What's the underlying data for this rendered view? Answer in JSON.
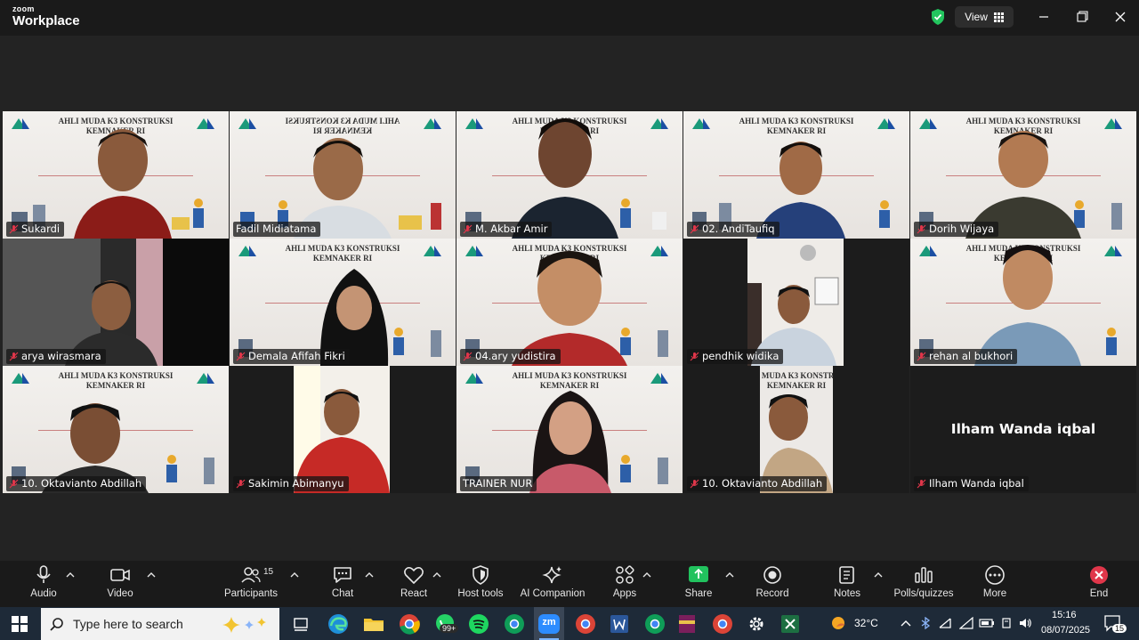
{
  "app": {
    "brand_small": "zoom",
    "brand_large": "Workplace"
  },
  "header": {
    "view_label": "View"
  },
  "banner": {
    "line1": "AHLI MUDA K3 KONSTRUKSI",
    "line2": "KEMNAKER RI"
  },
  "participants": [
    {
      "name": "Sukardi",
      "muted": true
    },
    {
      "name": "Fadil Midiatama",
      "muted": false,
      "active_speaker": true
    },
    {
      "name": "M. Akbar Amir",
      "muted": true
    },
    {
      "name": "02. AndiTaufiq",
      "muted": true
    },
    {
      "name": "Dorih Wijaya",
      "muted": true
    },
    {
      "name": "arya wirasmara",
      "muted": true
    },
    {
      "name": "Demala Afifah Fikri",
      "muted": true
    },
    {
      "name": "04.ary yudistira",
      "muted": true
    },
    {
      "name": "pendhik widika",
      "muted": true
    },
    {
      "name": "rehan al bukhori",
      "muted": true
    },
    {
      "name": "10. Oktavianto Abdillah",
      "muted": true
    },
    {
      "name": "Sakimin Abimanyu",
      "muted": true
    },
    {
      "name": "TRAINER NUR",
      "muted": false
    },
    {
      "name": "10. Oktavianto Abdillah",
      "muted": true
    },
    {
      "name": "Ilham Wanda iqbal",
      "muted": true,
      "video_off": true
    }
  ],
  "toolbar": {
    "audio": "Audio",
    "video": "Video",
    "participants": "Participants",
    "participants_count": "15",
    "chat": "Chat",
    "react": "React",
    "host_tools": "Host tools",
    "ai_companion": "AI Companion",
    "apps": "Apps",
    "share": "Share",
    "record": "Record",
    "notes": "Notes",
    "polls": "Polls/quizzes",
    "more": "More",
    "end": "End"
  },
  "taskbar": {
    "search_placeholder": "Type here to search",
    "whatsapp_badge": "99+",
    "zoom_label": "zm",
    "temperature": "32°C",
    "time": "15:16",
    "date": "08/07/2025",
    "notifications": "15"
  },
  "colors": {
    "active_speaker": "#2fd96f",
    "mute_red": "#e0364a",
    "share_green": "#21c25e",
    "end_red": "#e0364a",
    "taskbar": "#1e2a38"
  }
}
